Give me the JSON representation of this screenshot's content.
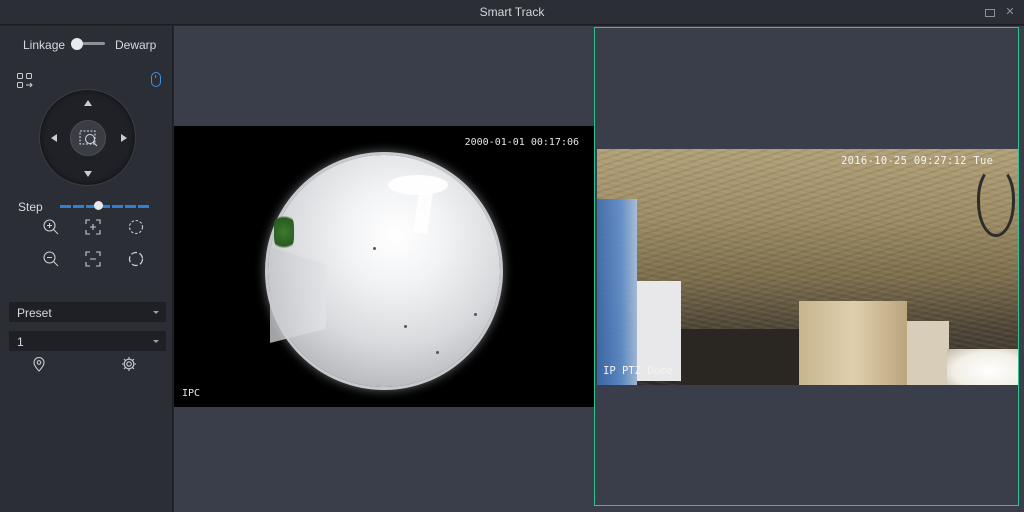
{
  "window": {
    "title": "Smart Track",
    "maximize_icon": "maximize-icon",
    "close_icon": "close-icon",
    "close_glyph": "✕"
  },
  "sidebar": {
    "linkage_label": "Linkage",
    "dewarp_label": "Dewarp",
    "toggle_state": "linkage",
    "step_label": "Step",
    "step_level": 0.42,
    "preset_label": "Preset",
    "preset_value": "1",
    "icons": {
      "layout": "grid-arrow-icon",
      "mouse": "mouse-icon",
      "zoom_in": "zoom-in-icon",
      "zoom_out": "zoom-out-icon",
      "focus_near": "focus-near-icon",
      "focus_far": "focus-far-icon",
      "iris_open": "iris-open-icon",
      "iris_close": "iris-close-icon",
      "locate": "location-pin-icon",
      "settings": "gear-icon",
      "center": "area-zoom-icon"
    }
  },
  "video_left": {
    "timestamp": "2000-01-01 00:17:06",
    "label": "IPC"
  },
  "video_right": {
    "timestamp": "2016-10-25 09:27:12 Tue",
    "label": "IP PTZ Dome"
  },
  "colors": {
    "accent": "#2f7fd6",
    "selection_border": "#2fc38f",
    "panel_bg": "#2b2e35",
    "view_bg": "#3a3e4a"
  }
}
